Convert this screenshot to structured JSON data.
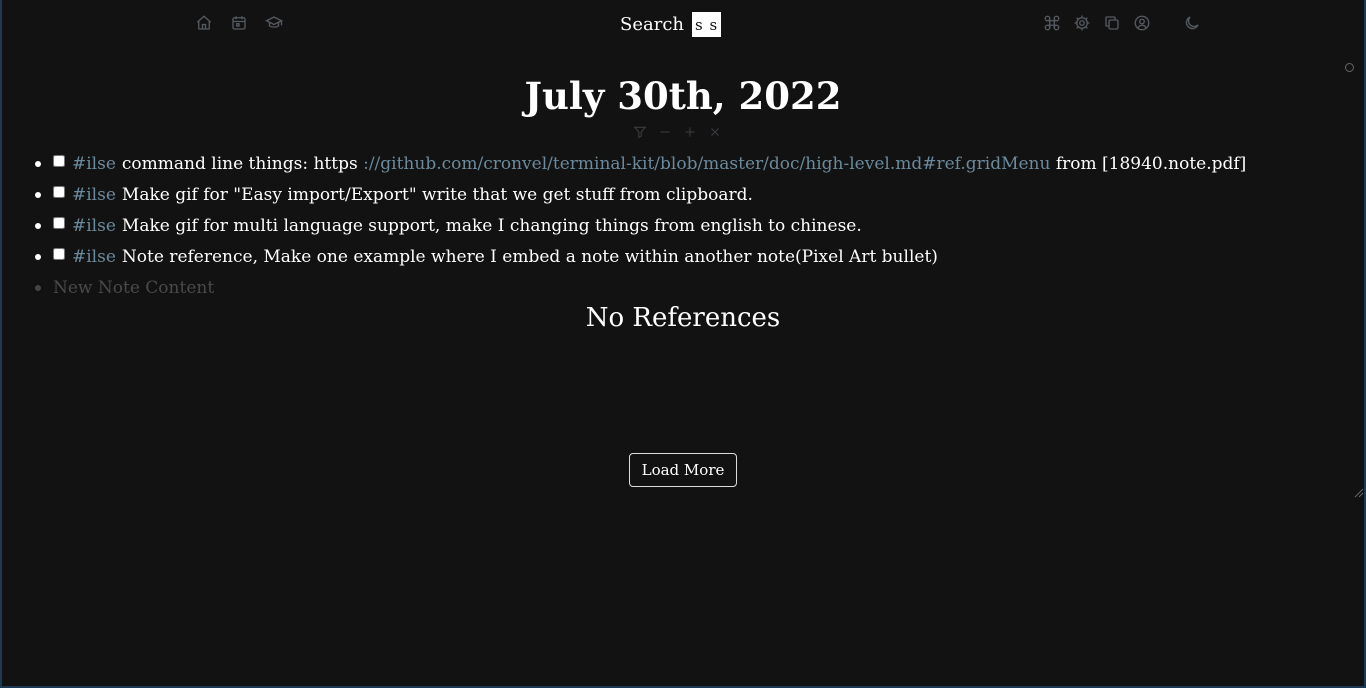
{
  "topbar": {
    "left_icons": [
      "home-icon",
      "calendar-icon",
      "graduation-cap-icon"
    ],
    "search_label": "Search",
    "search_value": "s s",
    "right_icons": [
      "command-icon",
      "gear-icon",
      "copy-icon",
      "user-circle-icon",
      "moon-icon"
    ]
  },
  "page": {
    "title": "July 30th, 2022",
    "title_tools": [
      "filter-icon",
      "minus-icon",
      "plus-icon",
      "close-icon"
    ]
  },
  "notes": [
    {
      "checked": false,
      "tag": "#ilse",
      "text_before": "command line things: https ",
      "link": "://github.com/cronvel/terminal-kit/blob/master/doc/high-level.md#ref.gridMenu",
      "text_after": " from [18940.note.pdf]"
    },
    {
      "checked": false,
      "tag": "#ilse",
      "text_before": "Make gif for \"Easy import/Export\" write that we get stuff from clipboard.",
      "link": "",
      "text_after": ""
    },
    {
      "checked": false,
      "tag": "#ilse",
      "text_before": "Make gif for multi language support, make I changing things from english to chinese.",
      "link": "",
      "text_after": ""
    },
    {
      "checked": false,
      "tag": "#ilse",
      "text_before": "Note reference, Make one example where I embed a note within another note(Pixel Art bullet)",
      "link": "",
      "text_after": ""
    }
  ],
  "new_note_placeholder": "New Note Content",
  "references": {
    "heading": "No References",
    "load_more_label": "Load More"
  },
  "colors": {
    "background": "#121212",
    "text": "#ffffff",
    "tag_link": "#6b8a9c",
    "muted_icon": "#555a60",
    "window_border": "#1d3a55"
  }
}
